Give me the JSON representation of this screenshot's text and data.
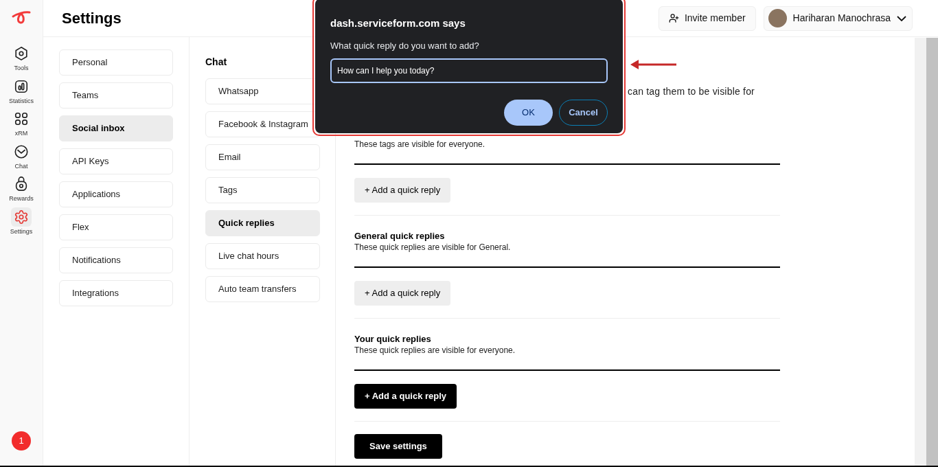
{
  "app": {
    "title": "Settings"
  },
  "rail": [
    {
      "label": "Tools",
      "selected": false
    },
    {
      "label": "Statistics",
      "selected": false
    },
    {
      "label": "xRM",
      "selected": false
    },
    {
      "label": "Chat",
      "selected": false
    },
    {
      "label": "Rewards",
      "selected": false
    },
    {
      "label": "Settings",
      "selected": true
    }
  ],
  "notification_badge": "1",
  "header": {
    "invite_button": "Invite member",
    "user": {
      "name": "Hariharan Manochrasa"
    }
  },
  "settings_menu": [
    {
      "label": "Personal",
      "selected": false
    },
    {
      "label": "Teams",
      "selected": false
    },
    {
      "label": "Social inbox",
      "selected": true
    },
    {
      "label": "API Keys",
      "selected": false
    },
    {
      "label": "Applications",
      "selected": false
    },
    {
      "label": "Flex",
      "selected": false
    },
    {
      "label": "Notifications",
      "selected": false
    },
    {
      "label": "Integrations",
      "selected": false
    }
  ],
  "submenu": {
    "title": "Chat",
    "items": [
      {
        "label": "Whatsapp",
        "selected": false
      },
      {
        "label": "Facebook & Instagram",
        "selected": false
      },
      {
        "label": "Email",
        "selected": false
      },
      {
        "label": "Tags",
        "selected": false
      },
      {
        "label": "Quick replies",
        "selected": true
      },
      {
        "label": "Live chat hours",
        "selected": false
      },
      {
        "label": "Auto team transfers",
        "selected": false
      }
    ]
  },
  "content": {
    "intro_visible": "can tag them to be visible for",
    "sections": [
      {
        "description": "These tags are visible for everyone.",
        "button": "+ Add a quick reply",
        "primary": false
      },
      {
        "title": "General quick replies",
        "description": "These quick replies are visible for General.",
        "button": "+ Add a quick reply",
        "primary": false
      },
      {
        "title": "Your quick replies",
        "description": "These quick replies are visible for everyone.",
        "button": "+ Add a quick reply",
        "primary": true
      }
    ],
    "save_button": "Save settings"
  },
  "dialog": {
    "title": "dash.serviceform.com says",
    "message": "What quick reply do you want to add?",
    "value": "How can I help you today?",
    "ok": "OK",
    "cancel": "Cancel"
  }
}
